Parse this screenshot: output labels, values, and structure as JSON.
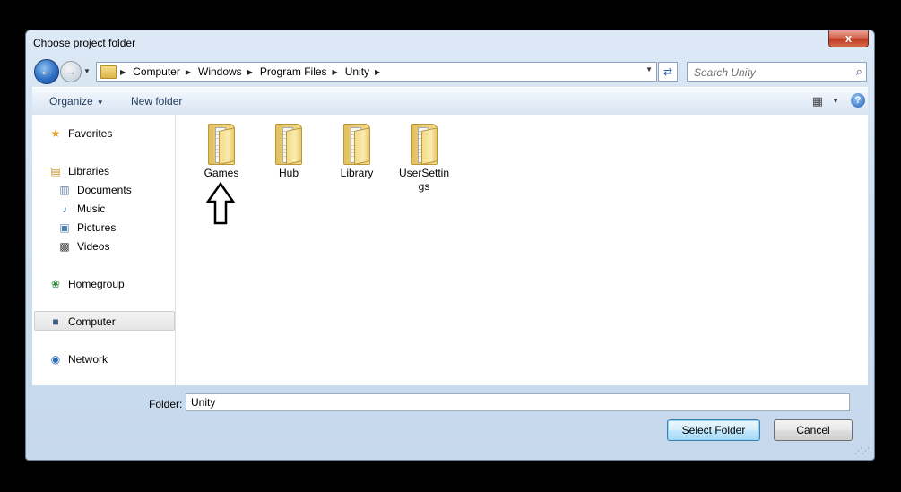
{
  "dialog": {
    "title": "Choose project folder",
    "close_glyph": "x"
  },
  "nav": {
    "back_glyph": "←",
    "forward_glyph": "→",
    "history_glyph": "▼",
    "breadcrumbs": [
      "Computer",
      "Windows",
      "Program Files",
      "Unity"
    ],
    "crumb_sep": "▶",
    "refresh_glyph": "⇄",
    "search_placeholder": "Search Unity",
    "search_glyph": "⌕"
  },
  "toolbar": {
    "organize_label": "Organize",
    "caret": "▼",
    "new_folder_label": "New folder",
    "views_glyph": "▦",
    "help_glyph": "?"
  },
  "sidebar": {
    "favorites": "Favorites",
    "libraries": "Libraries",
    "documents": "Documents",
    "music": "Music",
    "pictures": "Pictures",
    "videos": "Videos",
    "homegroup": "Homegroup",
    "computer": "Computer",
    "network": "Network",
    "icons": {
      "favorites": "★",
      "libraries": "▤",
      "documents": "▥",
      "music": "♪",
      "pictures": "▣",
      "videos": "▩",
      "homegroup": "❀",
      "computer": "■",
      "network": "◉"
    }
  },
  "content": {
    "folders": [
      "Games",
      "Hub",
      "Library",
      "UserSettings"
    ]
  },
  "footer": {
    "folder_label": "Folder:",
    "folder_value": "Unity",
    "select_label": "Select Folder",
    "cancel_label": "Cancel"
  }
}
